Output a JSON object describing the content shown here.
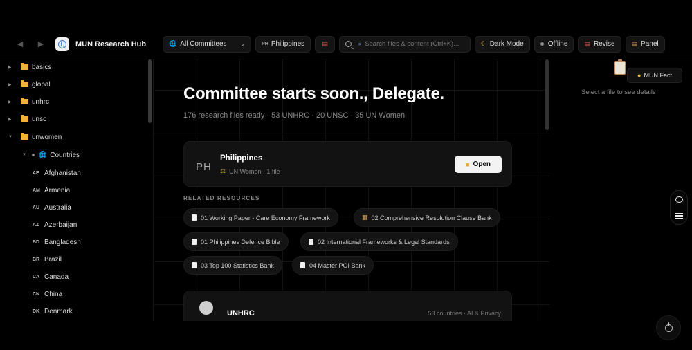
{
  "header": {
    "app_title": "MUN Research Hub",
    "committee_select": "All Committees",
    "country_code": "PH",
    "country_name": "Philippines",
    "search_placeholder": "Search files & content (Ctrl+K)...",
    "dark_mode_label": "Dark Mode",
    "offline_label": "Offline",
    "revise_label": "Revise",
    "panel_label": "Panel"
  },
  "sidebar": {
    "folders": [
      {
        "label": "basics",
        "expanded": false
      },
      {
        "label": "global",
        "expanded": false
      },
      {
        "label": "unhrc",
        "expanded": false
      },
      {
        "label": "unsc",
        "expanded": false
      },
      {
        "label": "unwomen",
        "expanded": true
      }
    ],
    "subfolder": {
      "label": "Countries"
    },
    "countries": [
      {
        "code": "AF",
        "name": "Afghanistan"
      },
      {
        "code": "AM",
        "name": "Armenia"
      },
      {
        "code": "AU",
        "name": "Australia"
      },
      {
        "code": "AZ",
        "name": "Azerbaijan"
      },
      {
        "code": "BD",
        "name": "Bangladesh"
      },
      {
        "code": "BR",
        "name": "Brazil"
      },
      {
        "code": "CA",
        "name": "Canada"
      },
      {
        "code": "CN",
        "name": "China"
      },
      {
        "code": "DK",
        "name": "Denmark"
      }
    ]
  },
  "main": {
    "headline": "Committee starts soon., Delegate.",
    "subline": "176 research files ready · 53 UNHRC · 20 UNSC · 35 UN Women",
    "delegation": {
      "code": "PH",
      "name": "Philippines",
      "meta": "UN Women · 1 file",
      "open_label": "Open"
    },
    "resources_heading": "RELATED RESOURCES",
    "resources": [
      {
        "label": "01 Working Paper - Care Economy Framework",
        "icon": "doc-icon"
      },
      {
        "label": "02 Comprehensive Resolution Clause Bank",
        "icon": "scroll-icon"
      },
      {
        "label": "01 Philippines Defence Bible",
        "icon": "doc-icon"
      },
      {
        "label": "02 International Frameworks & Legal Standards",
        "icon": "doc-icon"
      },
      {
        "label": "03 Top 100 Statistics Bank",
        "icon": "doc-icon"
      },
      {
        "label": "04 Master POI Bank",
        "icon": "doc-icon"
      }
    ],
    "committee": {
      "name": "UNHRC",
      "meta": "53 countries · AI & Privacy"
    }
  },
  "right_panel": {
    "fact_label": "MUN Fact",
    "detail_hint": "Select a file to see details"
  },
  "colors": {
    "background": "#000000",
    "folder": "#f2b23a",
    "accent_globe": "#3a7bd5"
  }
}
